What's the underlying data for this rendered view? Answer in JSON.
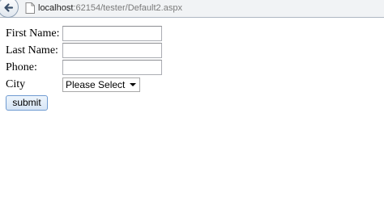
{
  "browser": {
    "url_host": "localhost",
    "url_rest": ":62154/tester/Default2.aspx"
  },
  "form": {
    "first_name_label": "First Name:",
    "first_name_value": "",
    "last_name_label": "Last Name:",
    "last_name_value": "",
    "phone_label": "Phone:",
    "phone_value": "",
    "city_label": "City",
    "city_selected": "Please Select",
    "submit_label": "submit"
  },
  "icons": {
    "back": "back-arrow-icon",
    "page": "page-icon",
    "dropdown": "chevron-down-icon"
  }
}
